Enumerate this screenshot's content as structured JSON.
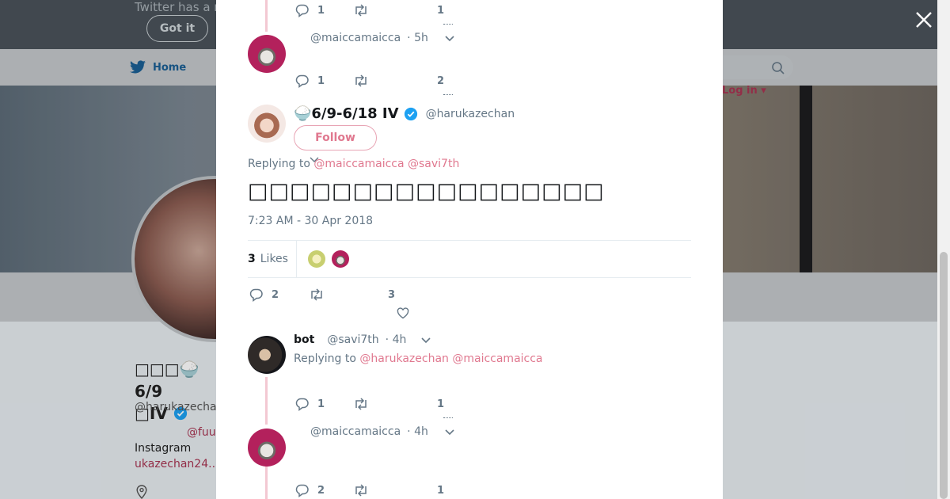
{
  "background": {
    "banner_text": "Twitter has a n",
    "got_it_label": "Got it",
    "nav_home_label": "Home",
    "login_label": "Log in",
    "profile_name": "□□□🍚6/9",
    "profile_name_line2": "□IV",
    "profile_handle": "@harukazechan",
    "bio_mention": "@fuu",
    "bio_instagram": "Instagram",
    "bio_link": "ukazechan24..."
  },
  "modal": {
    "close_label": "✕",
    "top_reply": {
      "reply_count": "1",
      "like_count": "1"
    },
    "reply_maicca_1": {
      "handle": "@maiccamaicca",
      "time": "· 5h",
      "reply_count": "1",
      "like_count": "2"
    },
    "main_tweet": {
      "display_name": "🍚6/9-6/18 IV",
      "handle": "@harukazechan",
      "follow_label": "Follow",
      "replying_to_label": "Replying to",
      "replying_mentions": "@maiccamaicca @savi7th",
      "text": "□□□□□□□□□□□□□□□□□",
      "timestamp": "7:23 AM - 30 Apr 2018",
      "likes_number": "3",
      "likes_label": "Likes",
      "reply_count": "2",
      "like_count": "3"
    },
    "reply_bot": {
      "display_name": "bot",
      "handle": "@savi7th",
      "time": "· 4h",
      "replying_to_label": "Replying to",
      "replying_mentions": "@harukazechan @maiccamaicca",
      "reply_count": "1",
      "like_count": "1"
    },
    "reply_maicca_2": {
      "handle": "@maiccamaicca",
      "time": "· 4h",
      "reply_count": "2",
      "like_count": "1"
    }
  }
}
